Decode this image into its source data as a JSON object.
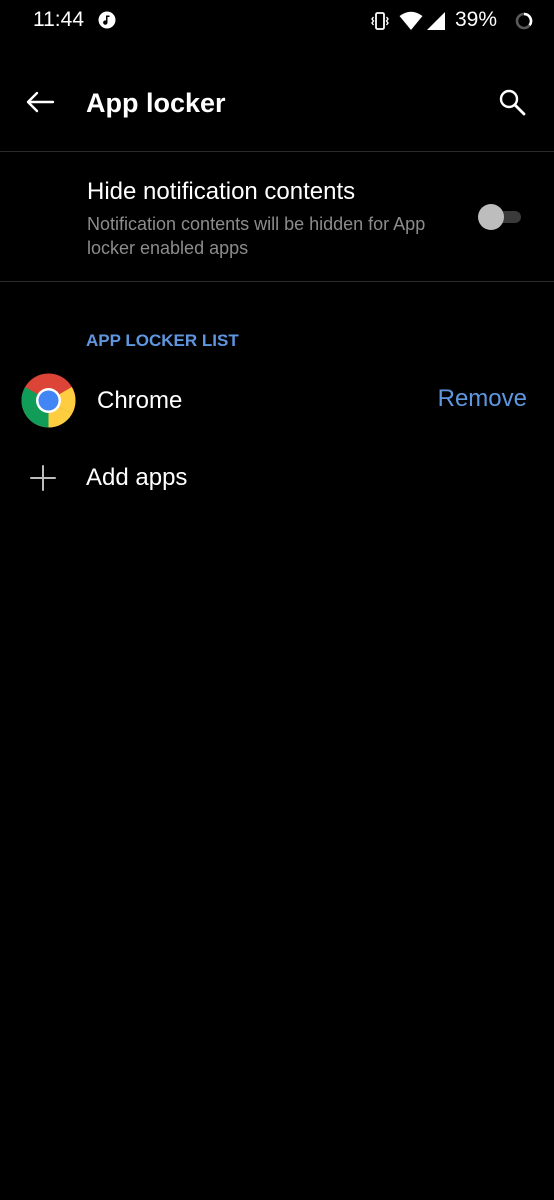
{
  "status_bar": {
    "time": "11:44",
    "battery": "39%",
    "icons": [
      "music-note-icon",
      "vibrate-icon",
      "wifi-icon",
      "signal-icon",
      "battery-icon"
    ]
  },
  "toolbar": {
    "title": "App locker",
    "back_icon": "back-arrow-icon",
    "search_icon": "search-icon"
  },
  "setting": {
    "title": "Hide notification contents",
    "summary": "Notification contents will be hidden for App locker enabled apps",
    "toggle_on": false
  },
  "section": {
    "header": "APP LOCKER LIST"
  },
  "apps": [
    {
      "name": "Chrome",
      "icon": "chrome-icon",
      "action": "Remove"
    }
  ],
  "add": {
    "label": "Add apps",
    "icon": "plus-icon"
  },
  "colors": {
    "background": "#000000",
    "accent": "#5e97e0",
    "secondary_text": "#8c8c8c",
    "divider": "#2b2b2b"
  }
}
